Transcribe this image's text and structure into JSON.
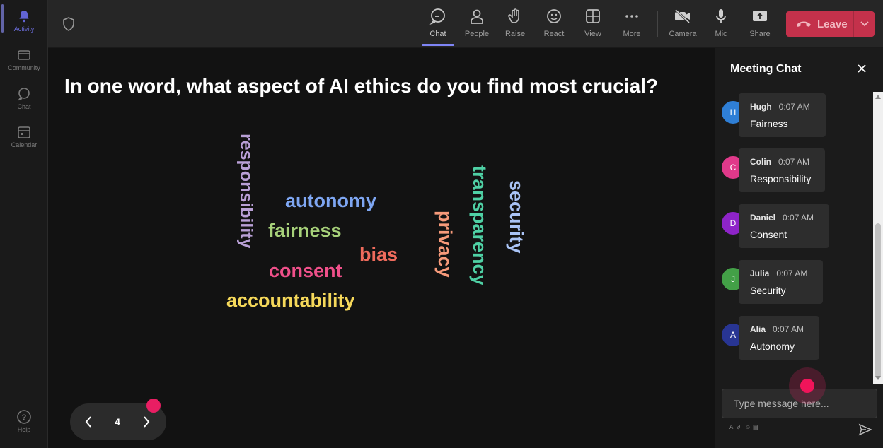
{
  "rail": {
    "items": [
      {
        "label": "Activity",
        "icon": "bell-icon"
      },
      {
        "label": "Community",
        "icon": "community-icon"
      },
      {
        "label": "Chat",
        "icon": "chat-icon"
      },
      {
        "label": "Calendar",
        "icon": "calendar-icon"
      },
      {
        "label": "Help",
        "icon": "help-icon"
      }
    ]
  },
  "toolbar": {
    "items": [
      {
        "label": "Chat",
        "icon": "chat-icon"
      },
      {
        "label": "People",
        "icon": "people-icon"
      },
      {
        "label": "Raise",
        "icon": "raise-hand-icon"
      },
      {
        "label": "React",
        "icon": "react-icon"
      },
      {
        "label": "View",
        "icon": "view-icon"
      },
      {
        "label": "More",
        "icon": "more-icon"
      },
      {
        "label": "Camera",
        "icon": "camera-off-icon"
      },
      {
        "label": "Mic",
        "icon": "mic-icon"
      },
      {
        "label": "Share",
        "icon": "share-icon"
      }
    ],
    "leave_label": "Leave",
    "leave_color": "#c4314b"
  },
  "stage": {
    "question": "In one word, what aspect of AI ethics do you find most crucial?",
    "words": [
      {
        "text": "responsibility",
        "color": "#b9a0d6"
      },
      {
        "text": "autonomy",
        "color": "#7ea6f2"
      },
      {
        "text": "fairness",
        "color": "#a7d17a"
      },
      {
        "text": "bias",
        "color": "#ef6b5c"
      },
      {
        "text": "consent",
        "color": "#f0508a"
      },
      {
        "text": "accountability",
        "color": "#f5d85a"
      },
      {
        "text": "privacy",
        "color": "#f79a7a"
      },
      {
        "text": "transparency",
        "color": "#4fd1a5"
      },
      {
        "text": "security",
        "color": "#a9c3f5"
      }
    ],
    "page_number": "4"
  },
  "chat": {
    "title": "Meeting Chat",
    "messages": [
      {
        "initial": "H",
        "name": "Hugh",
        "time": "0:07 AM",
        "text": "Fairness",
        "avatar_color": "#2f7fd6"
      },
      {
        "initial": "C",
        "name": "Colin",
        "time": "0:07 AM",
        "text": "Responsibility",
        "avatar_color": "#e0398a"
      },
      {
        "initial": "D",
        "name": "Daniel",
        "time": "0:07 AM",
        "text": "Consent",
        "avatar_color": "#8e24c8"
      },
      {
        "initial": "J",
        "name": "Julia",
        "time": "0:07 AM",
        "text": "Security",
        "avatar_color": "#43a047"
      },
      {
        "initial": "A",
        "name": "Alia",
        "time": "0:07 AM",
        "text": "Autonomy",
        "avatar_color": "#283593"
      }
    ],
    "input_placeholder": "Type message here..."
  }
}
